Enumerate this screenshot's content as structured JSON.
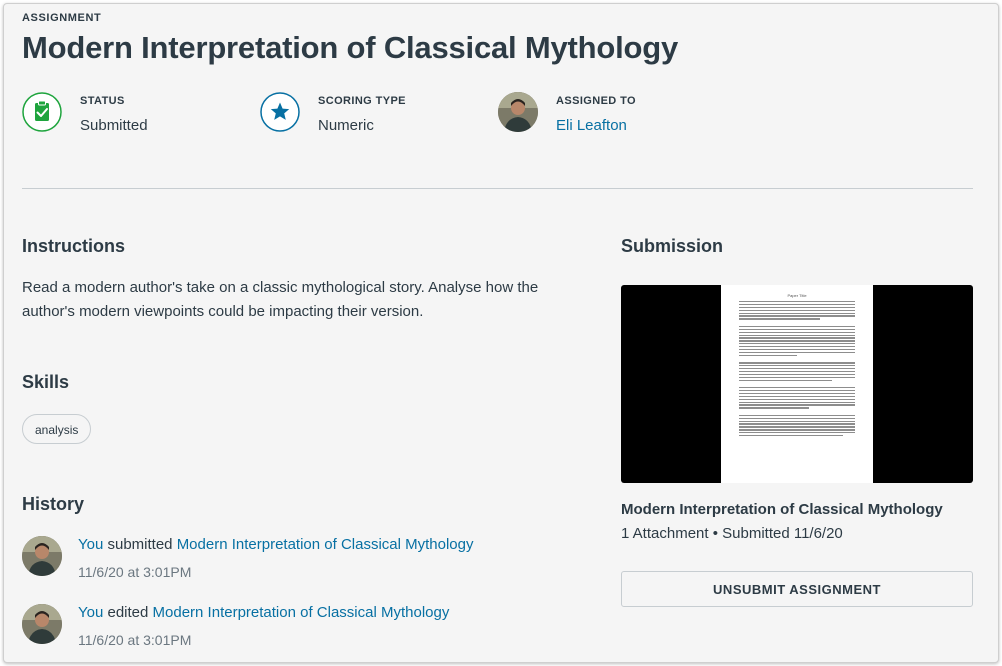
{
  "header": {
    "eyebrow": "ASSIGNMENT",
    "title": "Modern Interpretation of Classical Mythology"
  },
  "meta": {
    "status": {
      "label": "STATUS",
      "value": "Submitted",
      "icon": "clipboard-check-icon",
      "color": "#1ea43d"
    },
    "scoring": {
      "label": "SCORING TYPE",
      "value": "Numeric",
      "icon": "star-icon",
      "color": "#0770a3"
    },
    "assigned": {
      "label": "ASSIGNED TO",
      "value": "Eli Leafton",
      "icon": "avatar"
    }
  },
  "instructions": {
    "heading": "Instructions",
    "text": "Read a modern author's take on a classic mythological story. Analyse how the author's modern viewpoints could be impacting their version."
  },
  "skills": {
    "heading": "Skills",
    "items": [
      "analysis"
    ]
  },
  "history": {
    "heading": "History",
    "items": [
      {
        "actor": "You",
        "verb": " submitted ",
        "target": "Modern Interpretation of Classical Mythology",
        "time": "11/6/20 at 3:01PM"
      },
      {
        "actor": "You",
        "verb": " edited ",
        "target": "Modern Interpretation of Classical Mythology",
        "time": "11/6/20 at 3:01PM"
      }
    ]
  },
  "submission": {
    "heading": "Submission",
    "preview_doc_title": "Paper Title",
    "title": "Modern Interpretation of Classical Mythology",
    "meta": "1 Attachment • Submitted 11/6/20",
    "button_label": "UNSUBMIT ASSIGNMENT"
  },
  "colors": {
    "link": "#0770a3",
    "text": "#2d3b45",
    "success": "#1ea43d",
    "background": "#f5f5f5"
  }
}
